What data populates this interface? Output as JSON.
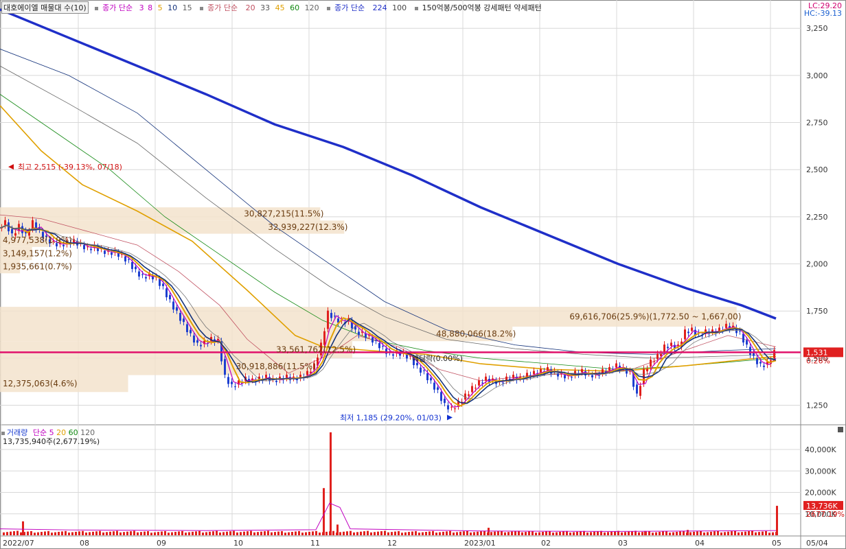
{
  "header": {
    "stock_box": "대호에이엘 매물대 수(10)",
    "ma_group1_label": "종가 단순",
    "ma_group1_periods": [
      "3",
      "8",
      "5",
      "10",
      "15"
    ],
    "ma_group2_label": "종가 단순",
    "ma_group2_periods": [
      "20",
      "33",
      "45",
      "60",
      "120"
    ],
    "ma_group3_label": "종가 단순",
    "ma_group3_periods": [
      "224",
      "100"
    ],
    "pattern_label": "150억봉/500억봉 강세패턴 약세패턴"
  },
  "corner": {
    "lc": "LC:29.20",
    "hc": "HC:-39.13"
  },
  "volume_header": {
    "label": "거래량",
    "ma_label": "단순",
    "ma_periods": [
      "5",
      "20",
      "60",
      "120"
    ],
    "last_volume": "13,735,940주(2,677.19%)"
  },
  "colors": {
    "up": "#e0201d",
    "down": "#1d3fd0",
    "ma3": "#c000c0",
    "ma5": "#e0a000",
    "ma10": "#12317a",
    "ma15": "#606060",
    "ma224": "#1f2fc8",
    "band": "#f3e3cc",
    "hline": "#e0106a",
    "ma20": "#c05060"
  },
  "chart_data": [
    {
      "type": "candlestick",
      "title": "",
      "x_ticks": [
        "2022/07",
        "08",
        "09",
        "10",
        "11",
        "12",
        "2023/01",
        "02",
        "03",
        "04",
        "05",
        "05/04"
      ],
      "ylim": [
        1150,
        3400
      ],
      "y_ticks": [
        "3,250",
        "3,000",
        "2,750",
        "2,500",
        "2,250",
        "2,000",
        "1,750",
        "1,500",
        "1,250"
      ],
      "y_tick_values": [
        3250,
        3000,
        2750,
        2500,
        2250,
        2000,
        1750,
        1500,
        1250
      ],
      "current_price": 1531,
      "current_price_label": "1,531",
      "current_change_label": "0.26%",
      "price_path": [
        [
          0,
          2190
        ],
        [
          10,
          2220
        ],
        [
          20,
          2150
        ],
        [
          30,
          2200
        ],
        [
          40,
          2150
        ],
        [
          50,
          2220
        ],
        [
          60,
          2170
        ],
        [
          70,
          2130
        ],
        [
          80,
          2110
        ],
        [
          90,
          2100
        ],
        [
          100,
          2110
        ],
        [
          110,
          2120
        ],
        [
          120,
          2100
        ],
        [
          130,
          2080
        ],
        [
          140,
          2090
        ],
        [
          150,
          2070
        ],
        [
          160,
          2060
        ],
        [
          170,
          2060
        ],
        [
          180,
          2040
        ],
        [
          190,
          2010
        ],
        [
          200,
          1960
        ],
        [
          210,
          1930
        ],
        [
          220,
          1940
        ],
        [
          230,
          1920
        ],
        [
          240,
          1870
        ],
        [
          250,
          1800
        ],
        [
          260,
          1740
        ],
        [
          270,
          1680
        ],
        [
          280,
          1620
        ],
        [
          290,
          1570
        ],
        [
          300,
          1580
        ],
        [
          310,
          1600
        ],
        [
          320,
          1590
        ],
        [
          330,
          1400
        ],
        [
          340,
          1350
        ],
        [
          350,
          1370
        ],
        [
          360,
          1390
        ],
        [
          370,
          1380
        ],
        [
          380,
          1390
        ],
        [
          390,
          1400
        ],
        [
          400,
          1380
        ],
        [
          410,
          1390
        ],
        [
          420,
          1400
        ],
        [
          430,
          1390
        ],
        [
          440,
          1400
        ],
        [
          450,
          1420
        ],
        [
          460,
          1460
        ],
        [
          470,
          1570
        ],
        [
          480,
          1740
        ],
        [
          490,
          1710
        ],
        [
          500,
          1690
        ],
        [
          510,
          1700
        ],
        [
          520,
          1640
        ],
        [
          530,
          1630
        ],
        [
          540,
          1610
        ],
        [
          550,
          1580
        ],
        [
          560,
          1550
        ],
        [
          570,
          1520
        ],
        [
          580,
          1530
        ],
        [
          590,
          1520
        ],
        [
          600,
          1500
        ],
        [
          610,
          1450
        ],
        [
          620,
          1420
        ],
        [
          630,
          1370
        ],
        [
          640,
          1320
        ],
        [
          650,
          1250
        ],
        [
          660,
          1230
        ],
        [
          670,
          1260
        ],
        [
          680,
          1300
        ],
        [
          690,
          1340
        ],
        [
          700,
          1370
        ],
        [
          710,
          1390
        ],
        [
          720,
          1380
        ],
        [
          730,
          1370
        ],
        [
          740,
          1390
        ],
        [
          750,
          1400
        ],
        [
          760,
          1390
        ],
        [
          770,
          1410
        ],
        [
          780,
          1420
        ],
        [
          790,
          1430
        ],
        [
          800,
          1440
        ],
        [
          810,
          1420
        ],
        [
          820,
          1410
        ],
        [
          830,
          1400
        ],
        [
          840,
          1420
        ],
        [
          850,
          1430
        ],
        [
          860,
          1410
        ],
        [
          870,
          1410
        ],
        [
          880,
          1430
        ],
        [
          890,
          1440
        ],
        [
          900,
          1460
        ],
        [
          910,
          1440
        ],
        [
          920,
          1420
        ],
        [
          930,
          1300
        ],
        [
          940,
          1430
        ],
        [
          950,
          1480
        ],
        [
          960,
          1510
        ],
        [
          970,
          1560
        ],
        [
          980,
          1570
        ],
        [
          990,
          1560
        ],
        [
          1000,
          1640
        ],
        [
          1010,
          1650
        ],
        [
          1020,
          1620
        ],
        [
          1030,
          1640
        ],
        [
          1040,
          1640
        ],
        [
          1050,
          1650
        ],
        [
          1060,
          1670
        ],
        [
          1070,
          1660
        ],
        [
          1080,
          1630
        ],
        [
          1090,
          1560
        ],
        [
          1100,
          1500
        ],
        [
          1110,
          1460
        ],
        [
          1120,
          1470
        ],
        [
          1130,
          1531
        ]
      ],
      "ma224_path": [
        [
          0,
          3350
        ],
        [
          100,
          3200
        ],
        [
          200,
          3050
        ],
        [
          300,
          2900
        ],
        [
          400,
          2740
        ],
        [
          500,
          2620
        ],
        [
          600,
          2470
        ],
        [
          700,
          2300
        ],
        [
          800,
          2150
        ],
        [
          900,
          2000
        ],
        [
          1000,
          1870
        ],
        [
          1080,
          1780
        ],
        [
          1130,
          1710
        ]
      ],
      "ma120_path": [
        [
          0,
          3050
        ],
        [
          100,
          2850
        ],
        [
          200,
          2640
        ],
        [
          300,
          2350
        ],
        [
          400,
          2080
        ],
        [
          480,
          1880
        ],
        [
          560,
          1720
        ],
        [
          650,
          1600
        ],
        [
          750,
          1550
        ],
        [
          850,
          1520
        ],
        [
          950,
          1500
        ],
        [
          1050,
          1510
        ],
        [
          1130,
          1520
        ]
      ],
      "ma100_path": [
        [
          0,
          3140
        ],
        [
          100,
          3000
        ],
        [
          200,
          2800
        ],
        [
          300,
          2500
        ],
        [
          400,
          2200
        ],
        [
          480,
          2000
        ],
        [
          560,
          1800
        ],
        [
          650,
          1650
        ],
        [
          750,
          1570
        ],
        [
          850,
          1530
        ],
        [
          950,
          1520
        ],
        [
          1050,
          1540
        ],
        [
          1130,
          1550
        ]
      ],
      "ma60_path": [
        [
          0,
          2900
        ],
        [
          80,
          2700
        ],
        [
          160,
          2500
        ],
        [
          240,
          2250
        ],
        [
          320,
          2050
        ],
        [
          400,
          1850
        ],
        [
          470,
          1700
        ],
        [
          540,
          1600
        ],
        [
          620,
          1540
        ],
        [
          700,
          1500
        ],
        [
          800,
          1470
        ],
        [
          900,
          1440
        ],
        [
          1000,
          1460
        ],
        [
          1130,
          1500
        ]
      ],
      "ma45_path": [
        [
          0,
          2840
        ],
        [
          60,
          2600
        ],
        [
          120,
          2420
        ],
        [
          200,
          2280
        ],
        [
          280,
          2120
        ],
        [
          360,
          1860
        ],
        [
          430,
          1620
        ],
        [
          470,
          1560
        ],
        [
          540,
          1540
        ],
        [
          620,
          1520
        ],
        [
          700,
          1470
        ],
        [
          800,
          1440
        ],
        [
          900,
          1430
        ],
        [
          1000,
          1460
        ],
        [
          1130,
          1510
        ]
      ],
      "ma20_path": [
        [
          0,
          2260
        ],
        [
          60,
          2240
        ],
        [
          120,
          2180
        ],
        [
          200,
          2100
        ],
        [
          260,
          1960
        ],
        [
          320,
          1780
        ],
        [
          360,
          1600
        ],
        [
          420,
          1420
        ],
        [
          480,
          1520
        ],
        [
          520,
          1620
        ],
        [
          580,
          1560
        ],
        [
          640,
          1440
        ],
        [
          700,
          1380
        ],
        [
          780,
          1410
        ],
        [
          860,
          1420
        ],
        [
          920,
          1440
        ],
        [
          980,
          1520
        ],
        [
          1060,
          1620
        ],
        [
          1130,
          1560
        ]
      ],
      "volume_profile": [
        {
          "label": "30,827,215(11.5%)",
          "y_from": 2230,
          "y_to": 2300,
          "width_frac": 0.4
        },
        {
          "label": "32,939,227(12.3%)",
          "y_from": 2160,
          "y_to": 2230,
          "width_frac": 0.43
        },
        {
          "label": "4,977,538(1.9%)",
          "y_from": 2090,
          "y_to": 2160,
          "width_frac": 0.065
        },
        {
          "label": "3,149,157(1.2%)",
          "y_from": 2020,
          "y_to": 2090,
          "width_frac": 0.04
        },
        {
          "label": "1,935,661(0.7%)",
          "y_from": 1950,
          "y_to": 2020,
          "width_frac": 0.025
        },
        {
          "label": "69,616,706(25.9%)(1,772.50 ~ 1,667.00)",
          "y_from": 1667,
          "y_to": 1772,
          "width_frac": 0.92
        },
        {
          "label": "48,880,066(18.2%)",
          "y_from": 1590,
          "y_to": 1667,
          "width_frac": 0.64
        },
        {
          "label": "33,561,762(12.5%)",
          "y_from": 1500,
          "y_to": 1590,
          "width_frac": 0.44
        },
        {
          "label": "30,918,886(11.5%)",
          "y_from": 1410,
          "y_to": 1500,
          "width_frac": 0.39
        },
        {
          "label": "12,375,063(4.6%)",
          "y_from": 1320,
          "y_to": 1410,
          "width_frac": 0.16
        }
      ],
      "annotations": [
        {
          "label": "최고 2,515 (-39.13%, 07/18)",
          "x": 12,
          "y": 2515,
          "color": "#d01010",
          "arrow": "left"
        },
        {
          "label": "최저 1,185 (29.20%, 01/03)",
          "x": 655,
          "y": 1185,
          "color": "#1030d0",
          "arrow": "right"
        },
        {
          "label": "배당락(0.00%)",
          "x": 600,
          "y": 1500,
          "color": "#222",
          "arrow": "none"
        }
      ]
    },
    {
      "type": "bar",
      "title": "",
      "y_ticks": [
        "40,000K",
        "30,000K",
        "20,000K",
        "10,000K"
      ],
      "y_tick_values": [
        40000,
        30000,
        20000,
        10000
      ],
      "ylim": [
        0,
        48000
      ],
      "last_volume_label": "13,736K",
      "last_pct_label": "2677.19%",
      "spikes": [
        [
          32,
          6500
        ],
        [
          470,
          22000
        ],
        [
          480,
          48000
        ],
        [
          490,
          5000
        ],
        [
          710,
          3500
        ],
        [
          938,
          2000
        ],
        [
          1000,
          2500
        ],
        [
          1130,
          13736
        ]
      ]
    }
  ]
}
